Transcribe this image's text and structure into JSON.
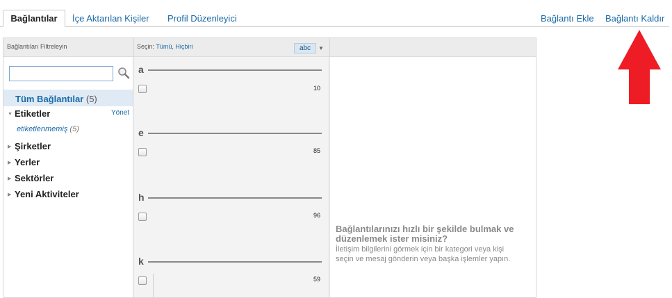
{
  "tabs": {
    "connections": "Bağlantılar",
    "imported": "İçe Aktarılan Kişiler",
    "profile_organizer": "Profil Düzenleyici"
  },
  "actions": {
    "add_connection": "Bağlantı Ekle",
    "remove_connection": "Bağlantı Kaldır"
  },
  "filter": {
    "title": "Bağlantıları Filtreleyin",
    "search_value": "",
    "all_connections_label": "Tüm Bağlantılar",
    "all_connections_count": "(5)",
    "tags_label": "Etiketler",
    "manage_label": "Yönet",
    "untagged_label": "etiketlenmemiş",
    "untagged_count": "(5)",
    "companies_label": "Şirketler",
    "locations_label": "Yerler",
    "industries_label": "Sektörler",
    "recent_activity_label": "Yeni Aktiviteler"
  },
  "selection": {
    "select_label": "Seçin:",
    "all_link": "Tümü",
    "separator": ", ",
    "none_link": "Hiçbiri",
    "sort_button": "abc"
  },
  "letter_groups": [
    {
      "letter": "a",
      "count": "10"
    },
    {
      "letter": "e",
      "count": "85"
    },
    {
      "letter": "h",
      "count": "96"
    },
    {
      "letter": "k",
      "count": "59"
    }
  ],
  "help": {
    "title": "Bağlantılarınızı hızlı bir şekilde bulmak ve düzenlemek ister misiniz?",
    "text": "İletişim bilgilerini görmek için bir kategori veya kişi seçin ve mesaj gönderin veya başka işlemler yapın."
  },
  "colors": {
    "link": "#1a6aa8",
    "selected_row": "#dfeaf5",
    "arrow": "#ee1c25"
  },
  "icons": {
    "search": "search-icon",
    "sort_caret": "chevron-down-icon",
    "expand": "triangle-right-icon",
    "collapse": "triangle-down-icon",
    "annotation": "red-arrow-up"
  }
}
